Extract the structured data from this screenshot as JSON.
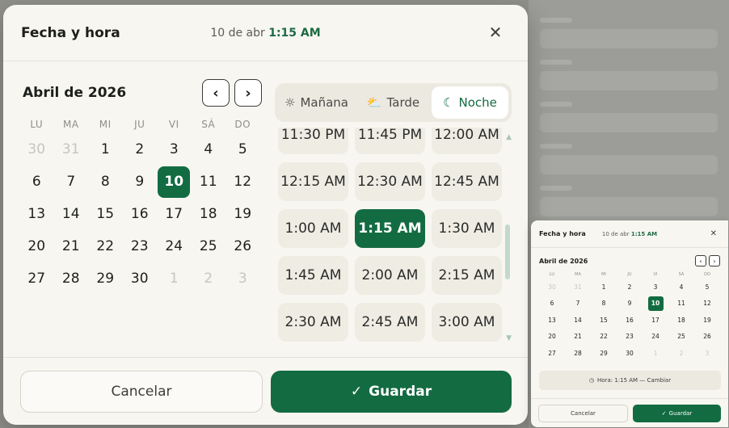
{
  "modal": {
    "title": "Fecha y hora",
    "summary_date": "10 de abr",
    "summary_time": "1:15 AM",
    "close_glyph": "✕"
  },
  "calendar": {
    "month_label": "Abril de 2026",
    "prev_glyph": "‹",
    "next_glyph": "›",
    "weekdays": [
      "LU",
      "MA",
      "MI",
      "JU",
      "VI",
      "SÁ",
      "DO"
    ],
    "days": [
      {
        "label": "30",
        "muted": true
      },
      {
        "label": "31",
        "muted": true
      },
      {
        "label": "1"
      },
      {
        "label": "2"
      },
      {
        "label": "3"
      },
      {
        "label": "4"
      },
      {
        "label": "5"
      },
      {
        "label": "6"
      },
      {
        "label": "7"
      },
      {
        "label": "8"
      },
      {
        "label": "9"
      },
      {
        "label": "10",
        "selected": true
      },
      {
        "label": "11"
      },
      {
        "label": "12"
      },
      {
        "label": "13"
      },
      {
        "label": "14"
      },
      {
        "label": "15"
      },
      {
        "label": "16"
      },
      {
        "label": "17"
      },
      {
        "label": "18"
      },
      {
        "label": "19"
      },
      {
        "label": "20"
      },
      {
        "label": "21"
      },
      {
        "label": "22"
      },
      {
        "label": "23"
      },
      {
        "label": "24"
      },
      {
        "label": "25"
      },
      {
        "label": "26"
      },
      {
        "label": "27"
      },
      {
        "label": "28"
      },
      {
        "label": "29"
      },
      {
        "label": "30"
      },
      {
        "label": "1",
        "muted": true
      },
      {
        "label": "2",
        "muted": true
      },
      {
        "label": "3",
        "muted": true
      }
    ]
  },
  "periods": [
    {
      "label": "Mañana",
      "icon": "sun-icon",
      "glyph": "☼",
      "active": false
    },
    {
      "label": "Tarde",
      "icon": "sunset-icon",
      "glyph": "⛅",
      "active": false
    },
    {
      "label": "Noche",
      "icon": "moon-icon",
      "glyph": "☾",
      "active": true
    }
  ],
  "time_slots": [
    {
      "label": "11:30 PM"
    },
    {
      "label": "11:45 PM"
    },
    {
      "label": "12:00 AM"
    },
    {
      "label": "12:15 AM"
    },
    {
      "label": "12:30 AM"
    },
    {
      "label": "12:45 AM"
    },
    {
      "label": "1:00 AM"
    },
    {
      "label": "1:15 AM",
      "selected": true
    },
    {
      "label": "1:30 AM"
    },
    {
      "label": "1:45 AM"
    },
    {
      "label": "2:00 AM"
    },
    {
      "label": "2:15 AM"
    },
    {
      "label": "2:30 AM"
    },
    {
      "label": "2:45 AM"
    },
    {
      "label": "3:00 AM"
    }
  ],
  "footer": {
    "cancel_label": "Cancelar",
    "save_label": "Guardar",
    "check_glyph": "✓"
  },
  "mini": {
    "title": "Fecha y hora",
    "summary_date": "10 de abr",
    "summary_time": "1:15 AM",
    "month_label": "Abril de 2026",
    "change_label": "Hora: 1:15 AM — Cambiar",
    "clock_glyph": "◷",
    "cancel_label": "Cancelar",
    "save_label": "Guardar"
  },
  "colors": {
    "accent": "#136b42",
    "surface": "#f8f6f0",
    "backdrop": "#8f908b"
  }
}
